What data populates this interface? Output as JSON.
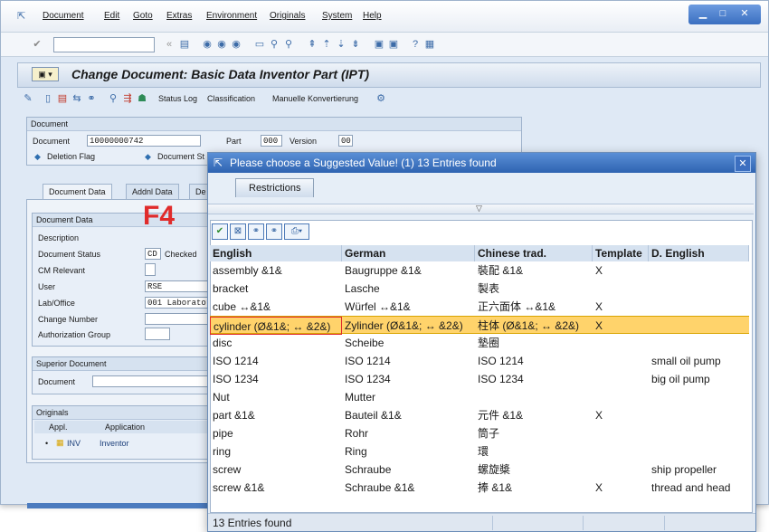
{
  "menu": {
    "items": [
      "Document",
      "Edit",
      "Goto",
      "Extras",
      "Environment",
      "Originals",
      "System",
      "Help"
    ]
  },
  "title": "Change Document: Basic Data Inventor Part (IPT)",
  "app_toolbar": {
    "status_log": "Status Log",
    "classification": "Classification",
    "manual_conversion": "Manuelle Konvertierung"
  },
  "document_group": {
    "header": "Document",
    "document_label": "Document",
    "document_value": "10000000742",
    "part_label": "Part",
    "part_value": "000",
    "version_label": "Version",
    "version_value": "00",
    "deletion_flag": "Deletion Flag",
    "document_status_trunc": "Document St"
  },
  "tabs": [
    "Document Data",
    "Addnl Data",
    "De"
  ],
  "document_data": {
    "header": "Document Data",
    "description_label": "Description",
    "status_label": "Document Status",
    "status_code": "CD",
    "status_text": "Checked",
    "cm_label": "CM Relevant",
    "user_label": "User",
    "user_value": "RSE",
    "lab_label": "Lab/Office",
    "lab_value": "001 Laboratory",
    "change_label": "Change Number",
    "auth_label": "Authorization Group"
  },
  "superior": {
    "header": "Superior Document",
    "document_label": "Document"
  },
  "originals": {
    "header": "Originals",
    "col_appl": "Appl.",
    "col_application": "Application",
    "appl_value": "INV",
    "application_value": "Inventor"
  },
  "annotation": "F4",
  "popup": {
    "title": "Please choose a Suggested Value! (1)   13 Entries found",
    "tab": "Restrictions",
    "status": "13 Entries found",
    "columns": [
      "English",
      "German",
      "Chinese trad.",
      "Template",
      "D. English"
    ],
    "rows": [
      [
        "assembly &1&",
        "Baugruppe &1&",
        "裝配 &1&",
        "X",
        ""
      ],
      [
        "bracket",
        "Lasche",
        "製表",
        "",
        ""
      ],
      [
        "cube ↔&1&",
        "Würfel ↔&1&",
        "正六面体 ↔&1&",
        "X",
        ""
      ],
      [
        "cylinder (Ø&1&; ↔ &2&)",
        "Zylinder (Ø&1&; ↔ &2&)",
        "柱体 (Ø&1&; ↔ &2&)",
        "X",
        ""
      ],
      [
        "disc",
        "Scheibe",
        "墊圈",
        "",
        ""
      ],
      [
        "ISO 1214",
        "ISO 1214",
        "ISO 1214",
        "",
        "small oil pump"
      ],
      [
        "ISO 1234",
        "ISO 1234",
        "ISO 1234",
        "",
        "big oil pump"
      ],
      [
        "Nut",
        "Mutter",
        "",
        "",
        ""
      ],
      [
        "part &1&",
        "Bauteil &1&",
        "元件 &1&",
        "X",
        ""
      ],
      [
        "pipe",
        "Rohr",
        "筒子",
        "",
        ""
      ],
      [
        "ring",
        "Ring",
        "環",
        "",
        ""
      ],
      [
        "screw",
        "Schraube",
        "螺旋槳",
        "",
        "ship propeller"
      ],
      [
        "screw &1&",
        "Schraube &1&",
        "捧 &1&",
        "X",
        "thread and head"
      ]
    ],
    "selected_row": 3
  },
  "colors": {
    "selection": "#ffd36b",
    "popup_title": "#2e63b1",
    "annotation": "#e02b2b"
  }
}
